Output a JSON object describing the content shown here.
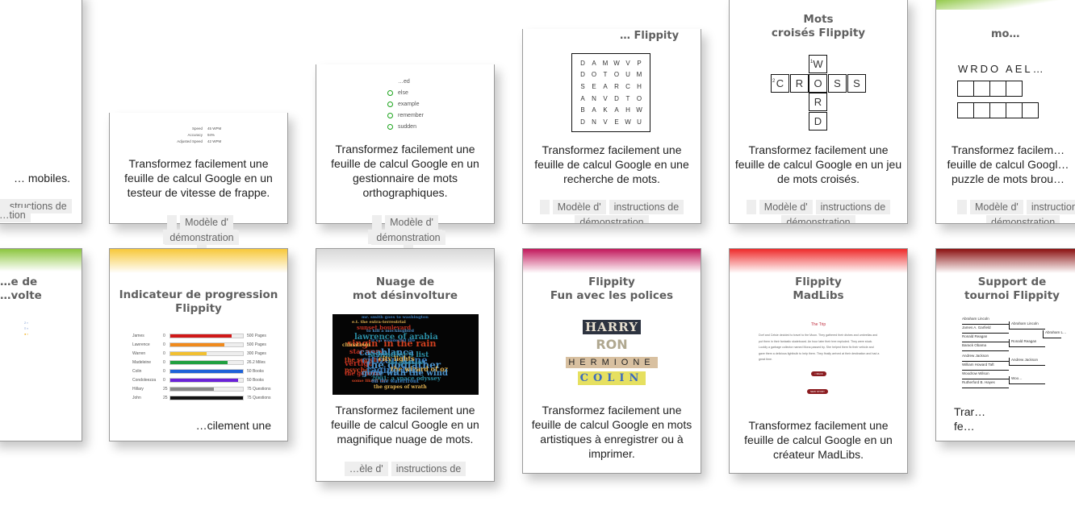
{
  "buttons": {
    "template": "Modèle d'",
    "instructions": "instructions de",
    "demo": "démonstration"
  },
  "cards_top": [
    {
      "id": "quiz-mobile",
      "desc_tail": "… mobiles.",
      "buttons_partial": {
        "instructions": "…structions de",
        "demo": "…tion"
      }
    },
    {
      "id": "typing-test",
      "stats": [
        {
          "label": "Speed",
          "value": "45 WPM"
        },
        {
          "label": "Accuracy",
          "value": "94%"
        },
        {
          "label": "Adjusted Speed",
          "value": "42 WPM"
        }
      ],
      "desc": "Transformez facilement une feuille de calcul Google en un testeur de vitesse de frappe."
    },
    {
      "id": "spelling",
      "words": [
        "…ed",
        "else",
        "example",
        "remember",
        "sudden"
      ],
      "desc": "Transformez facilement une feuille de calcul Google en un gestionnaire de mots orthographiques."
    },
    {
      "id": "word-search",
      "title_partial": "… Flippity",
      "grid": [
        "DAMWVP",
        "DOTOUM",
        "SEARCH",
        "ANVDTO",
        "BAKAHW",
        "DNVEWU"
      ],
      "desc": "Transformez facilement une feuille de calcul Google en une recherche de mots."
    },
    {
      "id": "crossword",
      "title_line1": "Mots",
      "title_line2": "croisés Flippity",
      "across": "CROSS",
      "down": "WORD",
      "num1": "1",
      "num2": "2",
      "desc": "Transformez facilement une feuille de calcul Google en un jeu de mots croisés."
    },
    {
      "id": "word-scramble",
      "title_partial": "mo…",
      "scramble": "WRDO AEL…",
      "desc": "Transformez facilem… feuille de calcul Googl… puzzle de mots brou…"
    }
  ],
  "cards_bottom": [
    {
      "id": "partial-left",
      "title_line1": "…e de",
      "title_line2": "…volte"
    },
    {
      "id": "progress",
      "title_line1": "Indicateur de progression",
      "title_line2": "Flippity",
      "rows": [
        {
          "name": "James",
          "start": "0",
          "end": "500 Pages",
          "fraction": 0.84,
          "color": "#d01818"
        },
        {
          "name": "Lawrence",
          "start": "0",
          "end": "500 Pages",
          "fraction": 0.74,
          "color": "#f08a1c"
        },
        {
          "name": "Warren",
          "start": "0",
          "end": "300 Pages",
          "fraction": 0.5,
          "color": "#f2c030"
        },
        {
          "name": "Madeleine",
          "start": "0",
          "end": "26.2 Miles",
          "fraction": 0.79,
          "color": "#20a040"
        },
        {
          "name": "Colin",
          "start": "0",
          "end": "50 Books",
          "fraction": 1.0,
          "color": "#1e62d8"
        },
        {
          "name": "Condoleezza",
          "start": "0",
          "end": "50 Books",
          "fraction": 0.93,
          "color": "#6a22d8"
        },
        {
          "name": "Hillary",
          "start": "25",
          "end": "75 Questions",
          "fraction": 0.6,
          "color": "#888888"
        },
        {
          "name": "John",
          "start": "25",
          "end": "75 Questions",
          "fraction": 1.0,
          "color": "#111111"
        }
      ],
      "desc_partial": "…cilement une"
    },
    {
      "id": "word-cloud",
      "title_line1": "Nuage de",
      "title_line2": "mot désinvolture",
      "words": [
        "mr. smith goes to washington",
        "e.t. the extra-terrestrial",
        "sunset boulevard",
        "to kill a mockingbird",
        "lawrence of arabia",
        "singin' in the rain",
        "it's a wonderful life",
        "chinatown",
        "star wars",
        "casablanca",
        "schindler's list",
        "the searchers",
        "citizen kane",
        "city lights",
        "vertigo",
        "the godfather",
        "the graduate",
        "psycho",
        "raging bull",
        "the wizard of oz",
        "the general",
        "gone with the wind",
        "2001: a space odyssey",
        "some like it hot",
        "on the waterfront",
        "the grapes of wrath"
      ],
      "desc": "Transformez facilement une feuille de calcul Google en un magnifique nuage de mots.",
      "buttons_partial": {
        "template": "…èle d'"
      }
    },
    {
      "id": "fonts",
      "title_line1": "Flippity",
      "title_line2": "Fun avec les polices",
      "samples": [
        "HARRY",
        "RON",
        "HERMIONE",
        "COLIN"
      ],
      "desc": "Transformez facilement une feuille de calcul Google en mots artistiques à enregistrer ou à imprimer."
    },
    {
      "id": "madlibs",
      "title_line1": "Flippity",
      "title_line2": "MadLibs",
      "story_title": "The Trip",
      "story": "Dorf and Celsie decided to travel to the Moon. They gathered their dishes and umbrellas and put them in their fantastic skateboard. An hour later their tree exploded. They were stuck. Luckily a garbage collector named Mona passed by. She helped them fix their vehicle and gave them a delicious lightbulb to help them. They finally arrived at their destination and had a great time.",
      "btn_back": "< BACK",
      "btn_new": "NEW STORY",
      "desc": "Transformez facilement une feuille de calcul Google en un créateur MadLibs."
    },
    {
      "id": "tournament",
      "title_line1": "Support de",
      "title_line2": "tournoi Flippity",
      "round1": [
        "Abraham Lincoln",
        "James A. Garfield",
        "Ronald Reagan",
        "Barack Obama",
        "Andrew Jackson",
        "William Howard Taft",
        "Woodrow Wilson",
        "Rutherford B. Hayes"
      ],
      "round2": [
        "Abraham Lincoln",
        "Ronald Reagan",
        "Andrew Jackson",
        "Woo…"
      ],
      "round3": [
        "Abraham L…"
      ],
      "desc_partial": "Trar… fe…"
    }
  ],
  "colors": {
    "green": "#8cc63f",
    "yellow": "#f7c83a",
    "grey": "#dcdcdc",
    "pink": "#c2185b",
    "red": "#ee2a2a",
    "darkred": "#8b1010"
  }
}
